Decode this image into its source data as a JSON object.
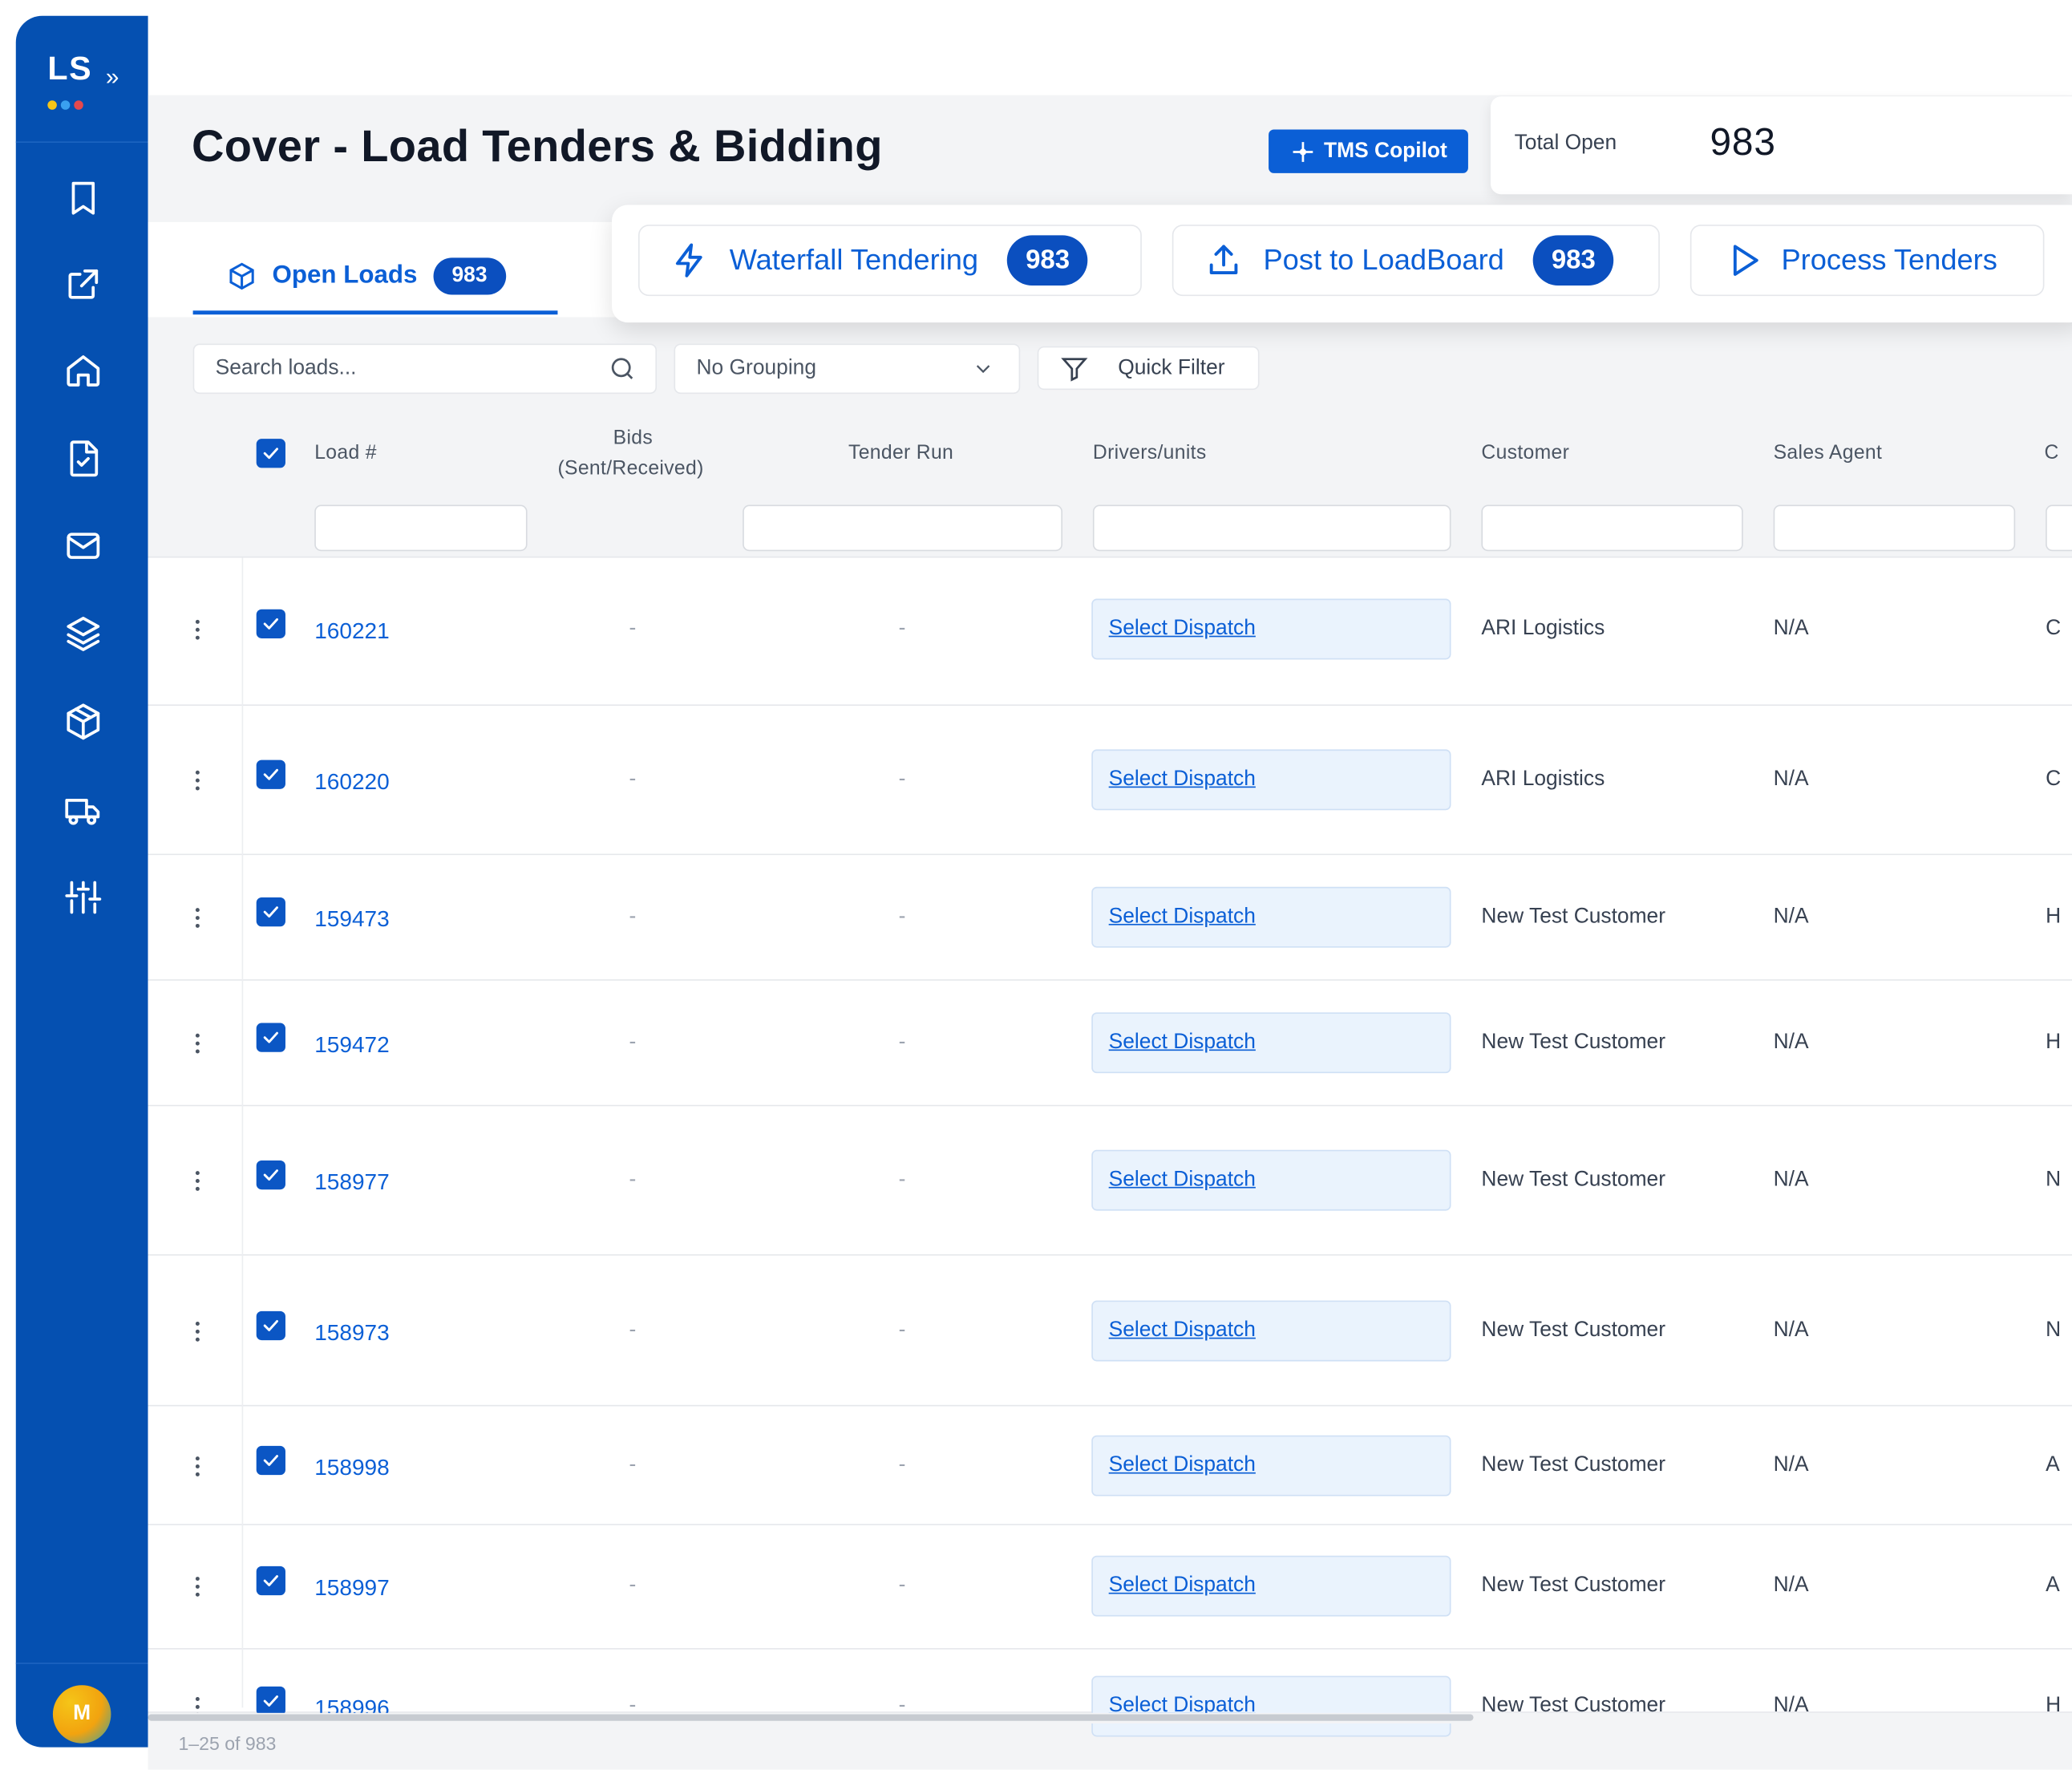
{
  "app": {
    "logo_text": "LS",
    "logo_chevron": "»",
    "user_initial": "M"
  },
  "sidebar": {
    "items": [
      {
        "icon": "bookmark-icon"
      },
      {
        "icon": "external-link-icon"
      },
      {
        "icon": "home-icon"
      },
      {
        "icon": "document-check-icon"
      },
      {
        "icon": "mail-icon"
      },
      {
        "icon": "layers-icon"
      },
      {
        "icon": "package-icon"
      },
      {
        "icon": "truck-icon"
      },
      {
        "icon": "sliders-icon"
      }
    ]
  },
  "header": {
    "title": "Cover - Load Tenders & Bidding",
    "copilot_label": "TMS Copilot"
  },
  "stats": {
    "total_open_label": "Total Open",
    "total_open_value": "983"
  },
  "tabs": {
    "open_loads_label": "Open Loads",
    "open_loads_count": "983"
  },
  "actions": [
    {
      "label": "Waterfall Tendering",
      "count": "983",
      "icon": "lightning-icon"
    },
    {
      "label": "Post to LoadBoard",
      "count": "983",
      "icon": "upload-icon"
    },
    {
      "label": "Process Tenders",
      "icon": "play-icon"
    }
  ],
  "toolbar": {
    "search_placeholder": "Search loads...",
    "grouping_value": "No Grouping",
    "quick_filter_label": "Quick Filter"
  },
  "table": {
    "columns": [
      "Load #",
      "Bids",
      "(Sent/Received)",
      "Tender Run",
      "Drivers/units",
      "Customer",
      "Sales Agent",
      "C"
    ],
    "rows": [
      {
        "load": "160221",
        "bids": "-",
        "tender_run": "-",
        "dispatch": "Select Dispatch",
        "customer": "ARI Logistics",
        "agent": "N/A",
        "next": "C"
      },
      {
        "load": "160220",
        "bids": "-",
        "tender_run": "-",
        "dispatch": "Select Dispatch",
        "customer": "ARI Logistics",
        "agent": "N/A",
        "next": "C"
      },
      {
        "load": "159473",
        "bids": "-",
        "tender_run": "-",
        "dispatch": "Select Dispatch",
        "customer": "New Test Customer",
        "agent": "N/A",
        "next": "H"
      },
      {
        "load": "159472",
        "bids": "-",
        "tender_run": "-",
        "dispatch": "Select Dispatch",
        "customer": "New Test Customer",
        "agent": "N/A",
        "next": "H"
      },
      {
        "load": "158977",
        "bids": "-",
        "tender_run": "-",
        "dispatch": "Select Dispatch",
        "customer": "New Test Customer",
        "agent": "N/A",
        "next": "N"
      },
      {
        "load": "158973",
        "bids": "-",
        "tender_run": "-",
        "dispatch": "Select Dispatch",
        "customer": "New Test Customer",
        "agent": "N/A",
        "next": "N"
      },
      {
        "load": "158998",
        "bids": "-",
        "tender_run": "-",
        "dispatch": "Select Dispatch",
        "customer": "New Test Customer",
        "agent": "N/A",
        "next": "A"
      },
      {
        "load": "158997",
        "bids": "-",
        "tender_run": "-",
        "dispatch": "Select Dispatch",
        "customer": "New Test Customer",
        "agent": "N/A",
        "next": "A"
      },
      {
        "load": "158996",
        "bids": "-",
        "tender_run": "-",
        "dispatch": "Select Dispatch",
        "customer": "New Test Customer",
        "agent": "N/A",
        "next": "H"
      }
    ]
  },
  "pagination": {
    "range_label": "1–25 of 983"
  },
  "colors": {
    "primary": "#0b5fd6",
    "sidebar": "#0550b1",
    "logo_dots": [
      "#f5c518",
      "#3aa0f0",
      "#e5484d"
    ]
  }
}
